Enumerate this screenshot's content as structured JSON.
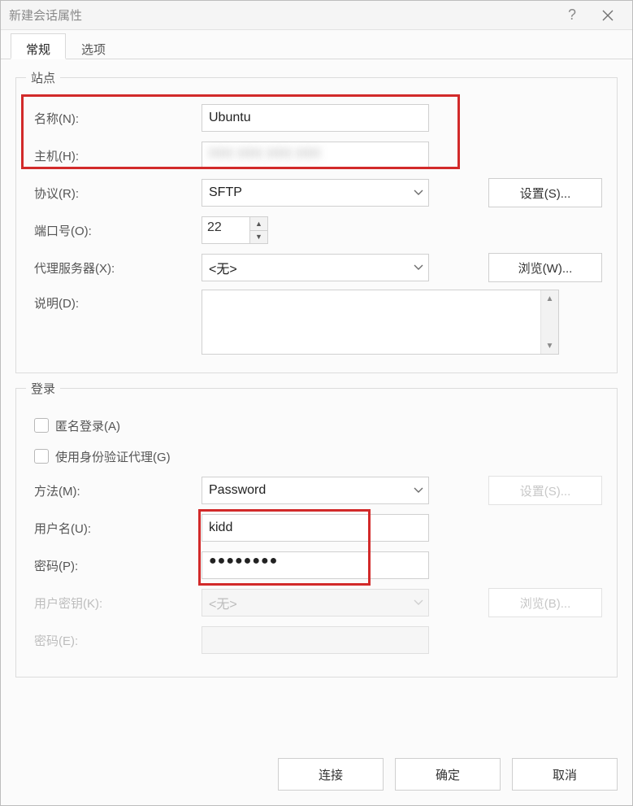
{
  "window": {
    "title": "新建会话属性"
  },
  "tabs": {
    "general": "常规",
    "options": "选项"
  },
  "site": {
    "legend": "站点",
    "name_label": "名称(N):",
    "name_value": "Ubuntu",
    "host_label": "主机(H):",
    "host_value": "xxx.xxx.xxx.xxx",
    "protocol_label": "协议(R):",
    "protocol_value": "SFTP",
    "settings_btn": "设置(S)...",
    "port_label": "端口号(O):",
    "port_value": "22",
    "proxy_label": "代理服务器(X):",
    "proxy_value": "<无>",
    "browse_btn": "浏览(W)...",
    "desc_label": "说明(D):"
  },
  "login": {
    "legend": "登录",
    "anon_label": "匿名登录(A)",
    "agent_label": "使用身份验证代理(G)",
    "method_label": "方法(M):",
    "method_value": "Password",
    "method_settings_btn": "设置(S)...",
    "user_label": "用户名(U):",
    "user_value": "kidd",
    "pass_label": "密码(P):",
    "pass_value": "●●●●●●●●",
    "key_label": "用户密钥(K):",
    "key_value": "<无>",
    "key_browse_btn": "浏览(B)...",
    "keypass_label": "密码(E):"
  },
  "footer": {
    "connect": "连接",
    "ok": "确定",
    "cancel": "取消"
  }
}
